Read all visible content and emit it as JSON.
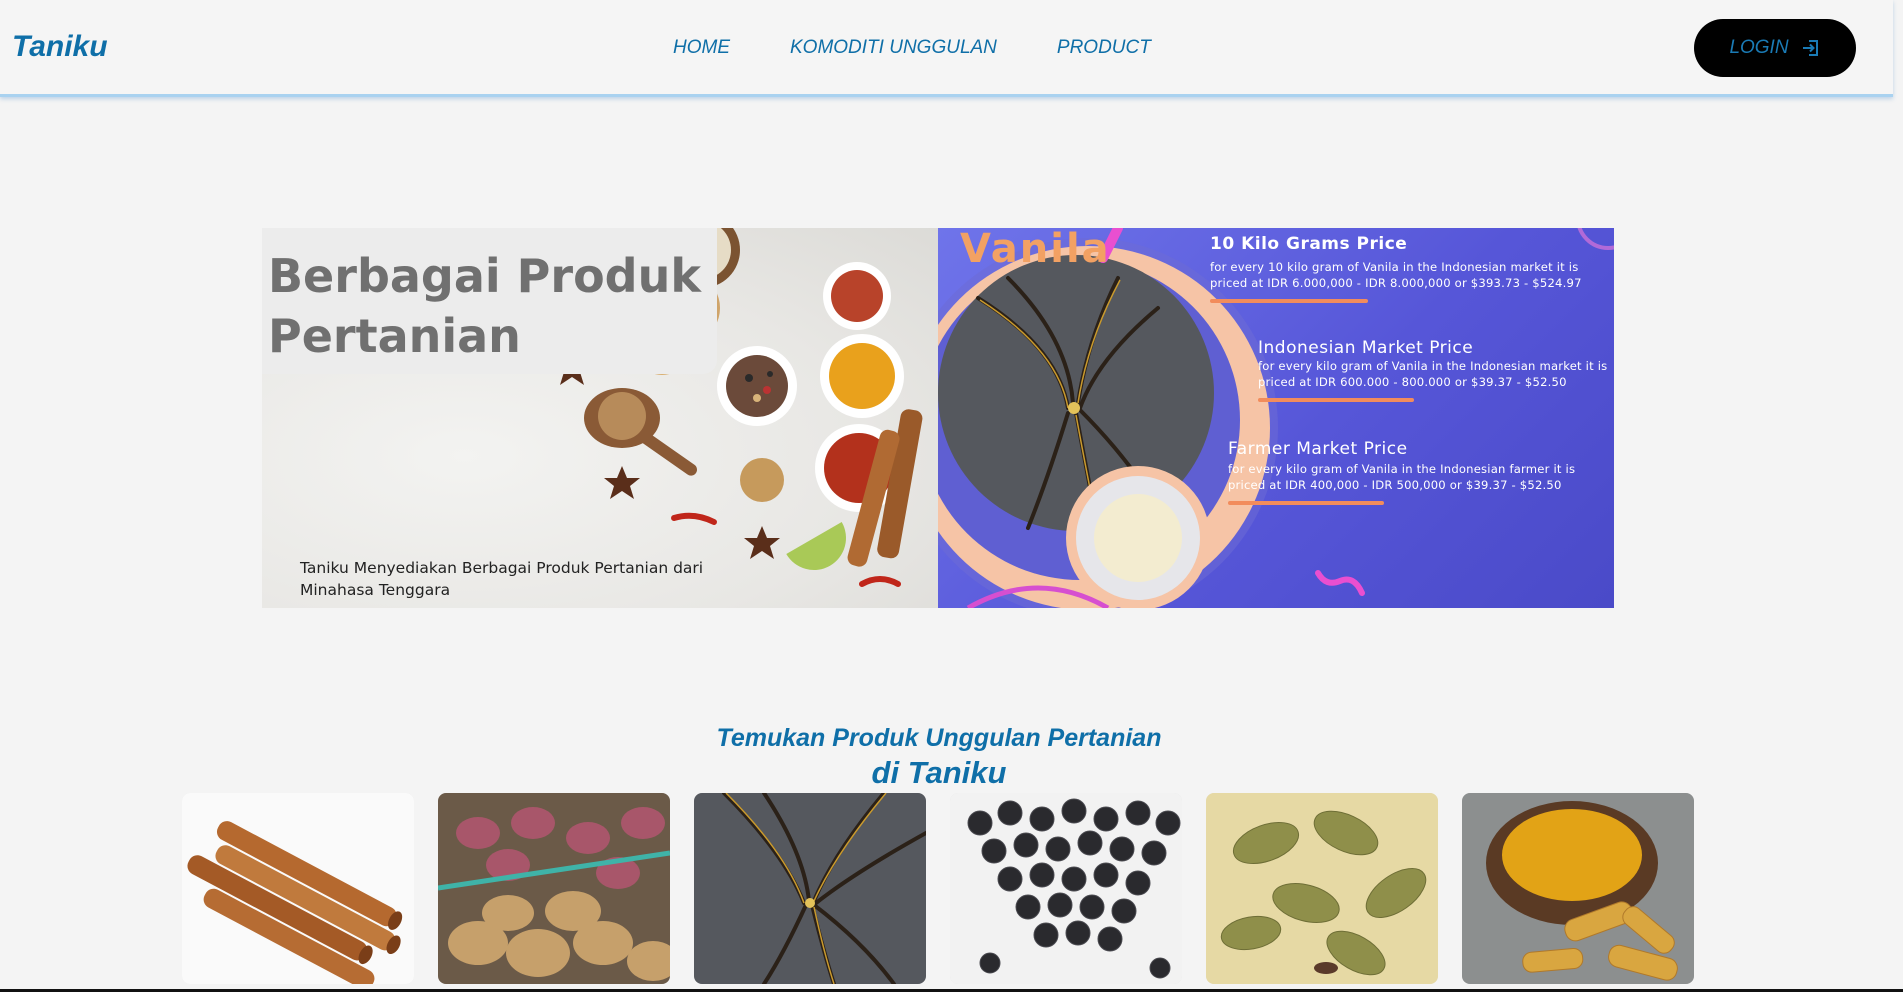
{
  "navbar": {
    "brand": "Taniku",
    "links": [
      {
        "label": "HOME"
      },
      {
        "label": "KOMODITI UNGGULAN"
      },
      {
        "label": "PRODUCT"
      }
    ],
    "login_label": "LOGIN",
    "login_icon": "login-icon"
  },
  "hero": {
    "left": {
      "title_line1": "Berbagai Produk",
      "title_line2": "Pertanian",
      "caption": "Taniku Menyediakan Berbagai Produk Pertanian dari Minahasa Tenggara"
    },
    "right": {
      "word": "Vanila",
      "prices": [
        {
          "title": "10  Kilo Grams Price",
          "desc": "for every 10 kilo gram of Vanila in the Indonesian market it is priced at IDR 6.000,000 - IDR 8.000,000 or $393.73 - $524.97"
        },
        {
          "title": "Indonesian Market Price",
          "desc": "for every kilo gram of Vanila in the Indonesian market it is priced at IDR 600.000 - 800.000 or $39.37 - $52.50"
        },
        {
          "title": "Farmer Market Price",
          "desc": "for every kilo gram of Vanila in the Indonesian farmer it is priced at IDR 400,000 - IDR 500,000 or $39.37 - $52.50"
        }
      ]
    }
  },
  "featured": {
    "subtitle": "Temukan Produk Unggulan Pertanian",
    "title": "di Taniku",
    "products": [
      {
        "name": "cinnamon"
      },
      {
        "name": "potato"
      },
      {
        "name": "vanilla"
      },
      {
        "name": "black-pepper"
      },
      {
        "name": "cardamom"
      },
      {
        "name": "turmeric"
      }
    ]
  },
  "colors": {
    "brand": "#0f6fa8",
    "login_bg": "#000000",
    "hero_right_bg": "#5a5adc",
    "accent_orange": "#f28c5c"
  }
}
